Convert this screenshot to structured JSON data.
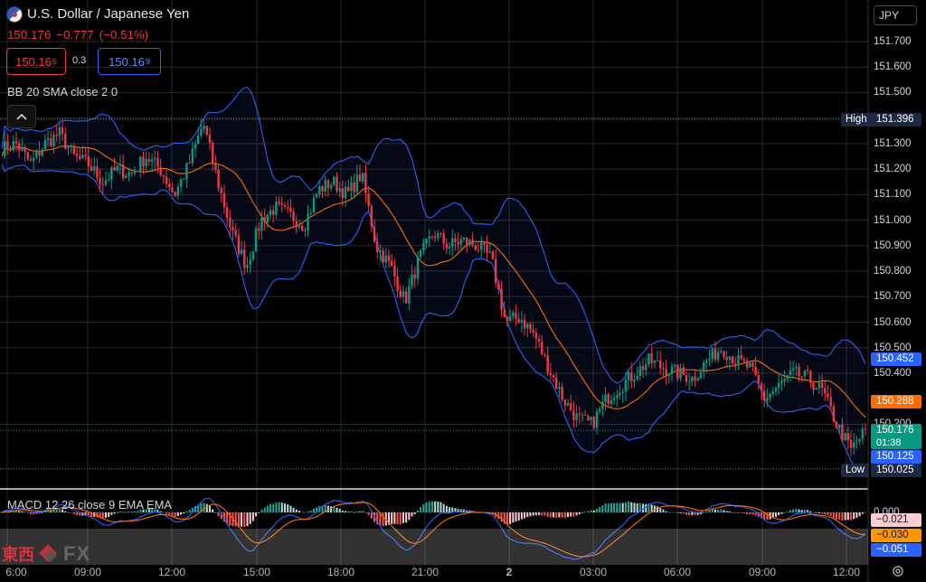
{
  "header": {
    "title": "U.S. Dollar / Japanese Yen",
    "last_price": "150.176",
    "change": "−0.777",
    "change_pct": "(−0.51%)",
    "sell_price_main": "150.16",
    "sell_price_sup": "6",
    "spread": "0.3",
    "buy_price_main": "150.16",
    "buy_price_sup": "9",
    "currency_button": "JPY"
  },
  "indicators": {
    "bb_label": "BB 20 SMA close 2 0",
    "macd_label": "MACD 12 26 close 9 EMA EMA"
  },
  "price_scale": {
    "ticks": [
      "151.700",
      "151.600",
      "151.500",
      "151.400",
      "151.300",
      "151.200",
      "151.100",
      "151.000",
      "150.900",
      "150.800",
      "150.700",
      "150.600",
      "150.500",
      "150.400",
      "150.200"
    ],
    "high_label": "High",
    "high_value": "151.396",
    "bb_upper_value": "150.452",
    "bb_mid_value": "150.288",
    "last_value": "150.176",
    "countdown": "01:38",
    "bb_lower_value": "150.125",
    "low_label": "Low",
    "low_value": "150.025",
    "macd_values": [
      "0.000",
      "−0.021",
      "−0.030",
      "−0.051"
    ]
  },
  "time_axis": [
    "6:00",
    "09:00",
    "12:00",
    "15:00",
    "18:00",
    "21:00",
    "2",
    "03:00",
    "06:00",
    "09:00",
    "12:00"
  ],
  "watermark": {
    "cn": "東西",
    "fx": "FX"
  },
  "colors": {
    "up": "#089981",
    "down": "#f23645",
    "bb_band": "#2962ff",
    "bb_basis": "#ff6d00",
    "macd_line": "#2962ff",
    "signal_line": "#ff6d00"
  },
  "chart_data": {
    "type": "candlestick",
    "y_range": [
      149.9,
      151.85
    ],
    "high": 151.396,
    "low": 150.025,
    "last": 150.176,
    "anchor_prices": [
      151.28,
      151.3,
      151.22,
      151.3,
      151.34,
      151.25,
      151.22,
      151.15,
      151.2,
      151.18,
      151.25,
      151.2,
      151.1,
      151.22,
      151.38,
      151.15,
      150.95,
      150.82,
      151.0,
      151.05,
      151.02,
      150.98,
      151.12,
      151.15,
      151.1,
      151.18,
      150.9,
      150.82,
      150.68,
      150.85,
      150.95,
      150.9,
      150.92,
      150.9,
      150.85,
      150.6,
      150.62,
      150.55,
      150.42,
      150.3,
      150.22,
      150.2,
      150.3,
      150.35,
      150.4,
      150.45,
      150.42,
      150.4,
      150.38,
      150.45,
      150.5,
      150.45,
      150.42,
      150.3,
      150.35,
      150.4,
      150.38,
      150.33,
      150.2,
      150.1,
      150.176
    ]
  }
}
